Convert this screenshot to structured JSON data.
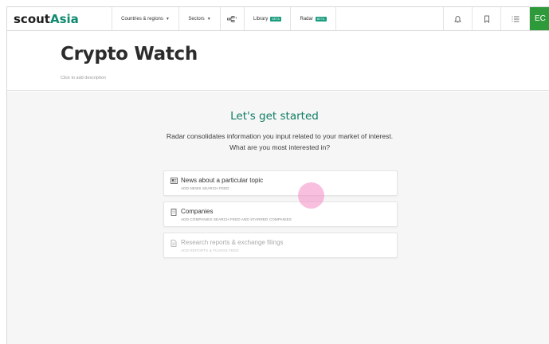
{
  "app": {
    "logo_part1": "scout",
    "logo_part2": "Asia"
  },
  "nav": {
    "countries": "Countries & regions",
    "sectors": "Sectors",
    "library": "Library",
    "radar": "Radar",
    "beta_badge": "BETA",
    "user_initials": "EC"
  },
  "page": {
    "title": "Crypto Watch",
    "description_placeholder": "Click to add description"
  },
  "getting_started": {
    "heading": "Let's get started",
    "line1": "Radar consolidates information you input related to your market of interest.",
    "line2": "What are you most interested in?"
  },
  "options": [
    {
      "title": "News about a particular topic",
      "subtitle": "ADD NEWS SEARCH FEED",
      "icon": "newspaper-icon"
    },
    {
      "title": "Companies",
      "subtitle": "ADD COMPANIES SEARCH FEED AND STARRED COMPANIES",
      "icon": "building-icon"
    },
    {
      "title": "Research reports & exchange filings",
      "subtitle": "ADD REPORTS & FILINGS FEED",
      "icon": "document-icon"
    }
  ],
  "colors": {
    "brand_green": "#0f8a6e",
    "avatar_green": "#2f9a3a",
    "beta_badge": "#1a9c7e"
  }
}
